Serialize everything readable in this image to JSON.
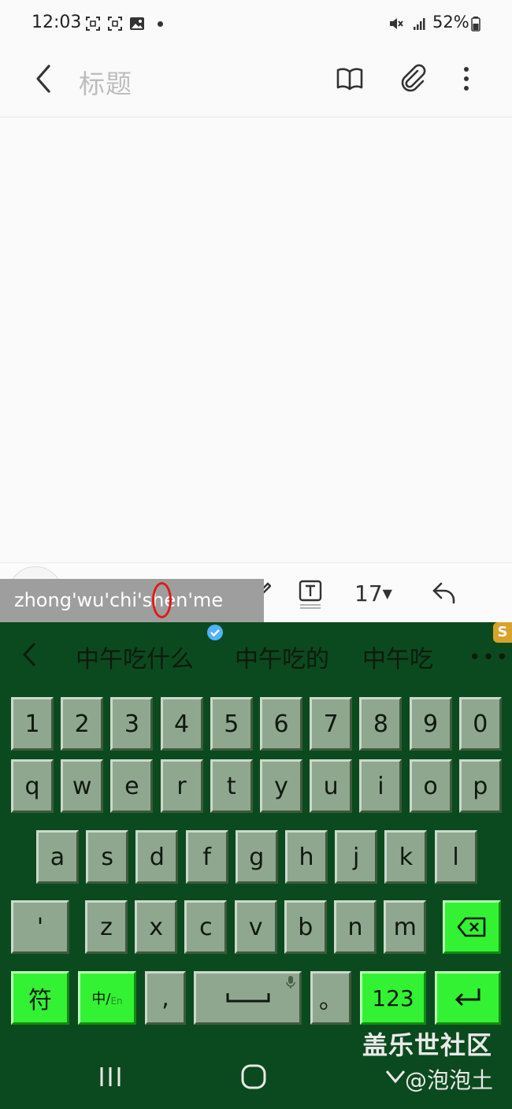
{
  "status_bar": {
    "time": "12:03",
    "battery": "52%"
  },
  "app_bar": {
    "title_placeholder": "标题"
  },
  "composing": {
    "pinyin": "zhong'wu'chi'shen'me"
  },
  "toolbar": {
    "font_size": "17"
  },
  "candidates": [
    "中午吃什么",
    "中午吃的",
    "中午吃"
  ],
  "keyboard": {
    "row_numbers": [
      "1",
      "2",
      "3",
      "4",
      "5",
      "6",
      "7",
      "8",
      "9",
      "0"
    ],
    "row_top": [
      "q",
      "w",
      "e",
      "r",
      "t",
      "y",
      "u",
      "i",
      "o",
      "p"
    ],
    "row_home": [
      "a",
      "s",
      "d",
      "f",
      "g",
      "h",
      "j",
      "k",
      "l"
    ],
    "row_bottom": [
      "'",
      "z",
      "x",
      "c",
      "v",
      "b",
      "n",
      "m"
    ],
    "symbols_label": "符",
    "lang_label_cn": "中/",
    "lang_label_en": "En",
    "comma": ",",
    "period": "。",
    "numbers_label": "123"
  },
  "watermark": {
    "line1": "盖乐世社区",
    "line2": "@泡泡土"
  },
  "colors": {
    "keyboard_bg": "#0b4a1e",
    "key_face": "#8fa78f",
    "accent_key": "#33f233",
    "title_placeholder": "#bdbdbd"
  }
}
